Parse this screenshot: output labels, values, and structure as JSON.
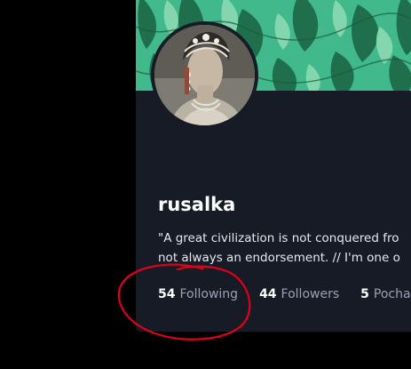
{
  "profile": {
    "display_name": "rusalka",
    "bio_lines": [
      "\"A great civilization is not conquered fro",
      "not always an endorsement. // I'm one o"
    ]
  },
  "stats": [
    {
      "count": "54",
      "label": "Following"
    },
    {
      "count": "44",
      "label": "Followers"
    },
    {
      "count": "5",
      "label": "Pocha"
    }
  ],
  "colors": {
    "page_background": "#000000",
    "card_background": "#161b26",
    "banner_green": "#3fb88a",
    "stat_label": "#9aa1b1",
    "annotation_red": "#e0001a"
  },
  "annotation": {
    "type": "hand-drawn circle",
    "target": "following-stat"
  }
}
